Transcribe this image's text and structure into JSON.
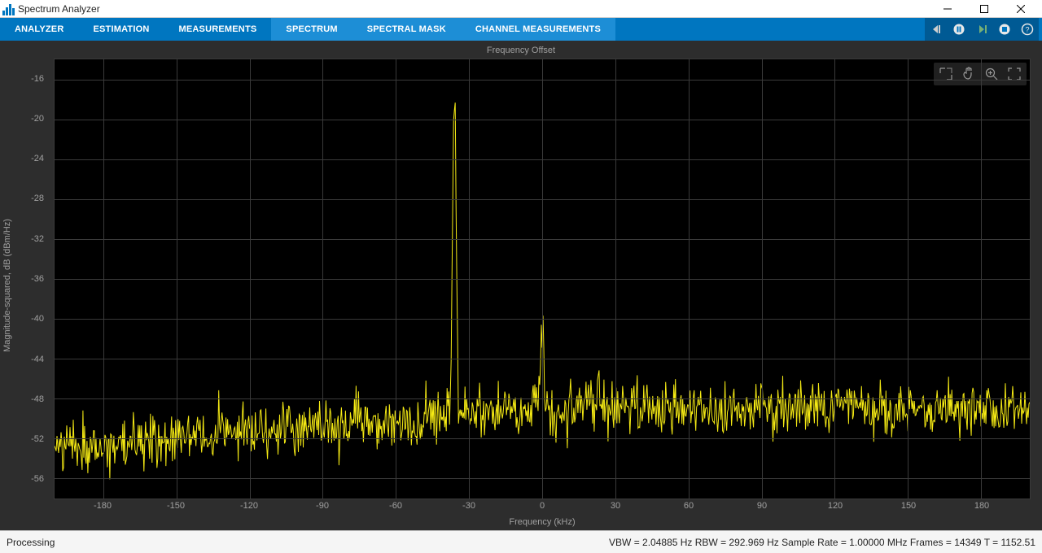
{
  "window": {
    "title": "Spectrum Analyzer"
  },
  "tabs": [
    {
      "label": "ANALYZER",
      "active": false
    },
    {
      "label": "ESTIMATION",
      "active": false
    },
    {
      "label": "MEASUREMENTS",
      "active": false
    },
    {
      "label": "SPECTRUM",
      "active": true
    },
    {
      "label": "SPECTRAL MASK",
      "active": true
    },
    {
      "label": "CHANNEL MEASUREMENTS",
      "active": true
    }
  ],
  "chart": {
    "title": "Frequency Offset",
    "xlabel": "Frequency (kHz)",
    "ylabel": "Magnitude-squared, dB (dBm/Hz)"
  },
  "chart_data": {
    "type": "line",
    "title": "Frequency Offset",
    "xlabel": "Frequency (kHz)",
    "ylabel": "Magnitude-squared, dB (dBm/Hz)",
    "xlim": [
      -200,
      200
    ],
    "ylim": [
      -58,
      -14
    ],
    "xticks": [
      -180,
      -150,
      -120,
      -90,
      -60,
      -30,
      0,
      30,
      60,
      90,
      120,
      150,
      180
    ],
    "yticks": [
      -16,
      -20,
      -24,
      -28,
      -32,
      -36,
      -40,
      -44,
      -48,
      -52,
      -56
    ],
    "noise_trend": [
      {
        "x": -200,
        "y": -53.0
      },
      {
        "x": -150,
        "y": -52.0
      },
      {
        "x": -100,
        "y": -51.0
      },
      {
        "x": -50,
        "y": -50.0
      },
      {
        "x": 0,
        "y": -49.0
      },
      {
        "x": 50,
        "y": -49.0
      },
      {
        "x": 100,
        "y": -49.0
      },
      {
        "x": 150,
        "y": -49.0
      },
      {
        "x": 200,
        "y": -49.0
      }
    ],
    "noise_std_db": 1.3,
    "peaks": [
      {
        "x": -36,
        "y": -15.5
      },
      {
        "x": 0,
        "y": -40.0
      }
    ]
  },
  "status": {
    "left": "Processing",
    "right": "VBW = 2.04885 Hz  RBW = 292.969 Hz  Sample Rate = 1.00000 MHz  Frames = 14349  T = 1152.51"
  }
}
